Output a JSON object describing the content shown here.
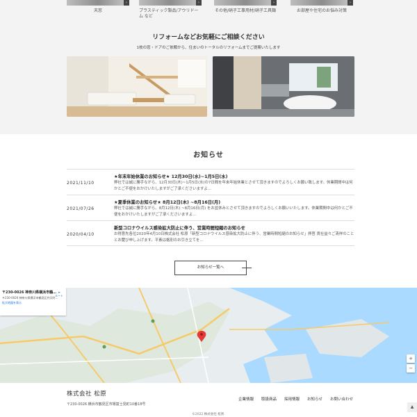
{
  "categories": [
    {
      "label": "天窓"
    },
    {
      "label": "プラスティック製品/アウリドーム など"
    },
    {
      "label": "その他/硝子工事用材/硝子工具類"
    },
    {
      "label": "お部屋や住宅のお悩み対策"
    }
  ],
  "reform": {
    "title": "リフォームなどお気軽にご相談ください",
    "subtitle": "1枚の窓・ドアのご依頼から、住まいのトータルのリフォームまでご提案いたします"
  },
  "news": {
    "title": "お知らせ",
    "items": [
      {
        "date": "2021/11/10",
        "head": "★年末年始休業のお知らせ★ 12月30日(水)~1月5日(水)",
        "body": "弊社では誠に勝手ながら、12月30日(木)~1月5日(水)の7日間を年末年始休業とさせて頂きますのでよろしくお願い致します。休業期間中は何かとご不便をおかけいたしますがご了承くださいますよ…"
      },
      {
        "date": "2021/07/26",
        "head": "★夏季休業のお知らせ★ 8月12日(木) ~8月16日(月)",
        "body": "弊社では誠に勝手ながら、8月12日(木) ~8月16日(月) をお盆休みとさせて頂きますのでよろしくお願いいたします。休業期間中は何かとご不便をおかけいたしますがご了承くださいますよ…"
      },
      {
        "date": "2020/04/10",
        "head": "新型コロナウイルス感染拡大防止に伴う、営業時間短縮のお知らせ",
        "body": "お得意先各位2020年4月10日株式会社 松原「新型コロナウイルス感染拡大防止に伴う、営業時間短縮のお知らせ」拝啓 貴社益々ご清祥のこととお慶び申し上げます。平素は格別のお引き立てを…"
      }
    ],
    "more_label": "お知らせ一覧へ"
  },
  "map": {
    "card_title": "〒230-0026 神奈川県横浜市鶴…",
    "card_address": "〒230-0026 神奈川県横浜市鶴見区弁天町…",
    "card_link": "拡大地図を表示",
    "route_label": "ルート",
    "zoom_in": "+",
    "zoom_out": "−"
  },
  "footer": {
    "company": "株式会社 松原",
    "address": "〒230-0026 横浜市鶴見区市場富士見町10番18号",
    "nav": [
      {
        "label": "企業情報"
      },
      {
        "label": "取扱商品"
      },
      {
        "label": "採用情報"
      },
      {
        "label": "お知らせ"
      },
      {
        "label": "お問い合わせ"
      }
    ],
    "copyright": "©2022 株式会社 松原.",
    "scroll_top": "▲"
  },
  "colors": {
    "map_water": "#aadaff",
    "map_land": "#e8eef0",
    "map_road": "#f6c96a",
    "pin": "#e53935"
  }
}
